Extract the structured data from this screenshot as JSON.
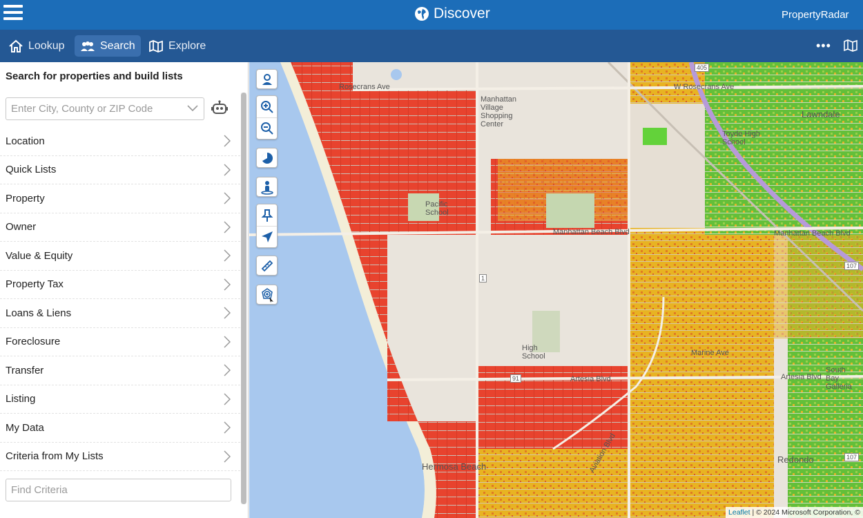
{
  "header": {
    "title": "Discover",
    "brand": "PropertyRadar"
  },
  "nav": {
    "tabs": [
      {
        "label": "Lookup",
        "icon": "home-icon"
      },
      {
        "label": "Search",
        "icon": "people-icon",
        "active": true
      },
      {
        "label": "Explore",
        "icon": "map-fold-icon"
      }
    ]
  },
  "sidebar": {
    "title": "Search for properties and build lists",
    "search": {
      "placeholder": "Enter City, County or ZIP Code"
    },
    "items": [
      {
        "label": "Location"
      },
      {
        "label": "Quick Lists"
      },
      {
        "label": "Property"
      },
      {
        "label": "Owner"
      },
      {
        "label": "Value & Equity"
      },
      {
        "label": "Property Tax"
      },
      {
        "label": "Loans & Liens"
      },
      {
        "label": "Foreclosure"
      },
      {
        "label": "Transfer"
      },
      {
        "label": "Listing"
      },
      {
        "label": "My Data"
      },
      {
        "label": "Criteria from My Lists"
      }
    ],
    "find": {
      "placeholder": "Find Criteria"
    }
  },
  "map": {
    "labels": {
      "rosecrans": "Rosecrans Ave",
      "w_rosecrans": "W Rosecrans Ave",
      "manhattan_village": "Manhattan Village Shopping Center",
      "toyde_high": "Toyde High School",
      "lawndale": "Lawndale",
      "pacific_school": "Pacific School",
      "mb_blvd": "Manhattan Beach Blvd",
      "mb_blvd_east": "Manhattan Beach Blvd",
      "high_school": "High School",
      "artesia": "Artesia Blvd",
      "artesia_east": "Artesia Blvd",
      "south_bay": "South Bay Galleria",
      "hermosa": "Hermosa Beach",
      "redondo": "Redondo",
      "aviation": "Aviation Blvd",
      "marine": "Marine Ave",
      "route_405": "405",
      "route_107": "107",
      "route_91": "91",
      "route_1": "1"
    },
    "attribution": {
      "leaflet": "Leaflet",
      "text": "| © 2024 Microsoft Corporation, ©"
    }
  },
  "colors": {
    "header_bg": "#1c6db8",
    "nav_bg": "#245894",
    "water": "#a8c8ee",
    "red_parcels": "#e8432e",
    "yellow_parcels": "#e8b322",
    "green_parcels": "#63bf3a"
  }
}
